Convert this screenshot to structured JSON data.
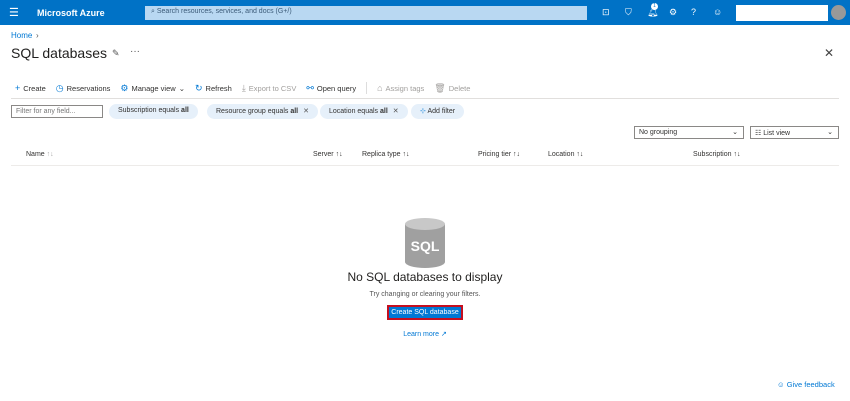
{
  "topbar": {
    "brand": "Microsoft Azure",
    "search_placeholder": "Search resources, services, and docs (G+/)",
    "notification_count": "1"
  },
  "breadcrumb": [
    "Home"
  ],
  "page": {
    "title": "SQL databases"
  },
  "toolbar": [
    {
      "label": "Create",
      "icon": "plus-icon",
      "enabled": true
    },
    {
      "label": "Reservations",
      "icon": "clock-icon",
      "enabled": true
    },
    {
      "label": "Manage view",
      "icon": "gear-icon",
      "enabled": true
    },
    {
      "label": "Refresh",
      "icon": "refresh-icon",
      "enabled": true
    },
    {
      "label": "Export to CSV",
      "icon": "download-icon",
      "enabled": false
    },
    {
      "label": "Open query",
      "icon": "query-icon",
      "enabled": true
    },
    {
      "label": "Assign tags",
      "icon": "tag-icon",
      "enabled": false
    },
    {
      "label": "Delete",
      "icon": "trash-icon",
      "enabled": false
    }
  ],
  "filters": {
    "placeholder": "Filter for any field...",
    "pills": [
      {
        "prefix": "Subscription equals ",
        "value": "all"
      },
      {
        "prefix": "Resource group equals ",
        "value": "all"
      },
      {
        "prefix": "Location equals ",
        "value": "all"
      }
    ],
    "add_filter": "Add filter"
  },
  "grouping": "No grouping",
  "view": "List view",
  "columns": [
    "Name",
    "Server",
    "Replica type",
    "Pricing tier",
    "Location",
    "Subscription"
  ],
  "empty": {
    "icon_text": "SQL",
    "title": "No SQL databases to display",
    "subtitle": "Try changing or clearing your filters.",
    "button": "Create SQL database",
    "learn_more": "Learn more"
  },
  "feedback": "Give feedback",
  "colors": {
    "accent": "#0078d4",
    "topbar": "#0072c6"
  }
}
